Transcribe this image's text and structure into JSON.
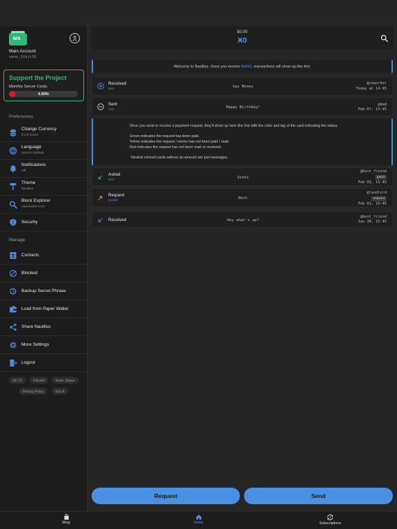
{
  "account": {
    "logo_text": "MA",
    "name": "Main Account",
    "address": "nano_1tkjc35"
  },
  "support": {
    "title": "Support the Project",
    "subtitle": "Monthly Server Costs",
    "progress_label": "0.00%",
    "progress_fraction": 0.0
  },
  "preferences": {
    "label": "Preferences",
    "items": [
      {
        "label": "Change Currency",
        "sub": "$ US Dollar",
        "icon": "database-icon"
      },
      {
        "label": "Language",
        "sub": "System Default",
        "icon": "globe-icon"
      },
      {
        "label": "Notifications",
        "sub": "Off",
        "icon": "bell-icon"
      },
      {
        "label": "Theme",
        "sub": "Nautilus",
        "icon": "paint-roller-icon"
      },
      {
        "label": "Block Explorer",
        "sub": "nanolooker.com",
        "icon": "search-icon"
      },
      {
        "label": "Security",
        "sub": "",
        "icon": "shield-icon"
      }
    ]
  },
  "manage": {
    "label": "Manage",
    "items": [
      {
        "label": "Contacts",
        "icon": "contacts-icon"
      },
      {
        "label": "Blocked",
        "icon": "blocked-icon"
      },
      {
        "label": "Backup Secret Phrase",
        "icon": "backup-icon"
      },
      {
        "label": "Load from Paper Wallet",
        "icon": "wallet-icon"
      },
      {
        "label": "Share Nautilus",
        "icon": "share-icon"
      },
      {
        "label": "More Settings",
        "icon": "gear-icon"
      },
      {
        "label": "Logout",
        "icon": "logout-icon"
      }
    ]
  },
  "footer_pills": [
    "v0.7.8",
    "Discord",
    "Node Status",
    "Privacy Policy",
    "EULA"
  ],
  "header": {
    "fiat_balance": "$0.00",
    "balance": "Ӿ0"
  },
  "welcome": {
    "before": "Welcome to Nautilus. Once you receive ",
    "highlight": "NANO",
    "after": ", transactions will show up like this:"
  },
  "cards_top": [
    {
      "title": "Received",
      "amount": "Ӿ50",
      "message": "Gas Money",
      "who": "@coworker",
      "time": "Today at 14:45",
      "icon": "plus-circle-icon"
    },
    {
      "title": "Sent",
      "amount": "Ӿ50",
      "message": "Happy Birthday!",
      "who": "@dad",
      "time": "Feb 07, 15:45",
      "icon": "minus-circle-icon"
    }
  ],
  "info_lines": [
    "Once you send or receive a payment request, they'll show up here like this with the color and tag of the card indicating the status.",
    "Green indicates the request has been paid.",
    "Yellow indicates the request / memo has not been paid / read.",
    "Red indicates the request has not been read or received.",
    "Neutral colored cards without an amount are just messages."
  ],
  "cards_bottom": [
    {
      "title": "Asked",
      "amount": "Ӿ10",
      "message": "Sushi",
      "who": "@best_friend",
      "tag": "paid",
      "time": "Feb 03, 15:45",
      "icon": "arrow-down-left-icon",
      "color": "#2fb67a"
    },
    {
      "title": "Request",
      "amount": "Ӿ1000",
      "message": "Rent",
      "who": "@landlord",
      "tag": "unpaid",
      "time": "Feb 01, 15:45",
      "icon": "arrow-up-right-icon",
      "color": "#e0a030"
    },
    {
      "title": "Received",
      "amount": "",
      "message": "Hey what's up?",
      "who": "@best_friend",
      "tag": "",
      "time": "Jan 30, 15:45",
      "icon": "arrow-down-left-icon",
      "color": "#4a90e2"
    }
  ],
  "buttons": {
    "request": "Request",
    "send": "Send"
  },
  "nav": {
    "shop": "Shop",
    "home": "Home",
    "subscriptions": "Subscriptions"
  },
  "colors": {
    "accent": "#4a90e2",
    "green": "#2fb67a",
    "red": "#d62020",
    "yellow": "#e0a030"
  }
}
